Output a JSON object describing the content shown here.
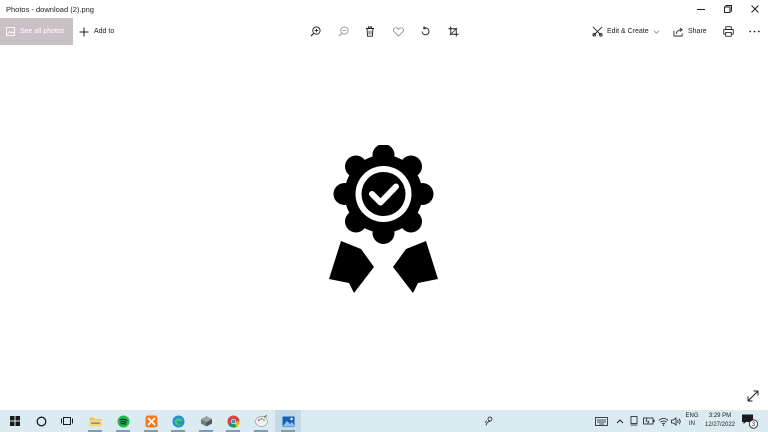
{
  "window": {
    "title": "Photos - download (2).png",
    "controls": [
      "minimize-icon",
      "restore-icon",
      "close-icon"
    ]
  },
  "toolbar": {
    "see_all_label": "See all photos",
    "add_to_label": "Add to",
    "tools": [
      "zoom-in-icon",
      "zoom-out-icon",
      "delete-icon",
      "favorite-icon",
      "rotate-icon",
      "crop-icon"
    ],
    "edit_create_label": "Edit & Create",
    "share_label": "Share",
    "print_icon": "print-icon",
    "more_icon": "more-icon"
  },
  "image": {
    "subject": "award-badge-icon",
    "color": "#000000"
  },
  "taskbar": {
    "apps": [
      "windows-start-icon",
      "cortana-search-icon",
      "task-view-icon",
      "file-explorer-icon",
      "spotify-icon",
      "xampp-icon",
      "edge-icon",
      "storage-app-icon",
      "chrome-icon",
      "paint-icon",
      "photos-icon"
    ],
    "tray_icons": [
      "people-icon",
      "keyboard-icon",
      "chevron-up-icon",
      "device-icon",
      "battery-icon",
      "wifi-icon",
      "volume-icon"
    ],
    "language_line1": "ENG",
    "language_line2": "IN",
    "time": "3:29 PM",
    "date": "12/27/2022",
    "notification_count": "3",
    "bg_color": "#dcebf2"
  }
}
